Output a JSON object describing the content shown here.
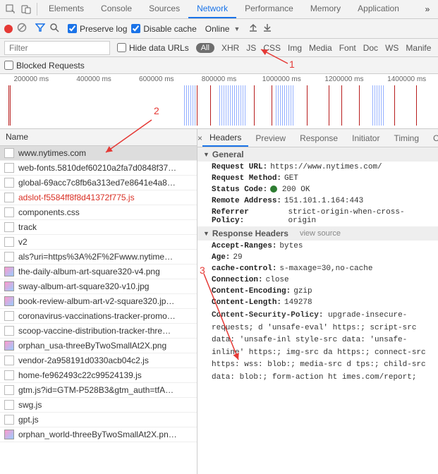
{
  "topbar": {
    "tabs": [
      "Elements",
      "Console",
      "Sources",
      "Network",
      "Performance",
      "Memory",
      "Application"
    ],
    "activeTab": "Network"
  },
  "subtoolbar": {
    "preserve_log": "Preserve log",
    "disable_cache": "Disable cache",
    "throttle": "Online"
  },
  "filterbar": {
    "placeholder": "Filter",
    "hide_data_urls": "Hide data URLs",
    "all_pill": "All",
    "types": [
      "XHR",
      "JS",
      "CSS",
      "Img",
      "Media",
      "Font",
      "Doc",
      "WS",
      "Manife"
    ]
  },
  "blocked": {
    "label": "Blocked Requests"
  },
  "timeline": {
    "ticks": [
      "200000 ms",
      "400000 ms",
      "600000 ms",
      "800000 ms",
      "1000000 ms",
      "1200000 ms",
      "1400000 ms"
    ]
  },
  "requests": {
    "header": "Name",
    "items": [
      {
        "name": "www.nytimes.com",
        "sel": true
      },
      {
        "name": "web-fonts.5810def60210a2fa7d0848f37…"
      },
      {
        "name": "global-69acc7c8fb6a313ed7e8641e4a8…"
      },
      {
        "name": "adslot-f5584ff8f8d41372f775.js",
        "red": true
      },
      {
        "name": "components.css"
      },
      {
        "name": "track"
      },
      {
        "name": "v2"
      },
      {
        "name": "als?uri=https%3A%2F%2Fwww.nytime…"
      },
      {
        "name": "the-daily-album-art-square320-v4.png",
        "img": true
      },
      {
        "name": "sway-album-art-square320-v10.jpg",
        "img": true
      },
      {
        "name": "book-review-album-art-v2-square320.jp…",
        "img": true
      },
      {
        "name": "coronavirus-vaccinations-tracker-promo…"
      },
      {
        "name": "scoop-vaccine-distribution-tracker-thre…"
      },
      {
        "name": "orphan_usa-threeByTwoSmallAt2X.png",
        "img": true
      },
      {
        "name": "vendor-2a958191d0330acb04c2.js"
      },
      {
        "name": "home-fe962493c22c99524139.js"
      },
      {
        "name": "gtm.js?id=GTM-P528B3&gtm_auth=tfA…"
      },
      {
        "name": "swg.js"
      },
      {
        "name": "gpt.js"
      },
      {
        "name": "orphan_world-threeByTwoSmallAt2X.pn…",
        "img": true
      }
    ]
  },
  "detail": {
    "tabs": [
      "Headers",
      "Preview",
      "Response",
      "Initiator",
      "Timing",
      "C"
    ],
    "activeTab": "Headers",
    "general": {
      "title": "General",
      "url_k": "Request URL:",
      "url_v": "https://www.nytimes.com/",
      "method_k": "Request Method:",
      "method_v": "GET",
      "status_k": "Status Code:",
      "status_v": "200 OK",
      "remote_k": "Remote Address:",
      "remote_v": "151.101.1.164:443",
      "referrer_k": "Referrer Policy:",
      "referrer_v": "strict-origin-when-cross-origin"
    },
    "response_headers": {
      "title": "Response Headers",
      "view_source": "view source",
      "accept_k": "Accept-Ranges:",
      "accept_v": "bytes",
      "age_k": "Age:",
      "age_v": "29",
      "cache_k": "cache-control:",
      "cache_v": "s-maxage=30,no-cache",
      "conn_k": "Connection:",
      "conn_v": "close",
      "enc_k": "Content-Encoding:",
      "enc_v": "gzip",
      "len_k": "Content-Length:",
      "len_v": "149278",
      "csp_k": "Content-Security-Policy:",
      "csp_v": "upgrade-insecure-requests; d 'unsafe-eval' https:; script-src data: 'unsafe-inl style-src data: 'unsafe-inline' https:; img-src da https:; connect-src https: wss: blob:; media-src d tps:; child-src data: blob:; form-action ht imes.com/report;"
    }
  },
  "annotations": {
    "a1": "1",
    "a2": "2",
    "a3": "3"
  },
  "colors": {
    "accent": "#1a73e8",
    "error": "#d93025",
    "arrow": "#e53935"
  }
}
